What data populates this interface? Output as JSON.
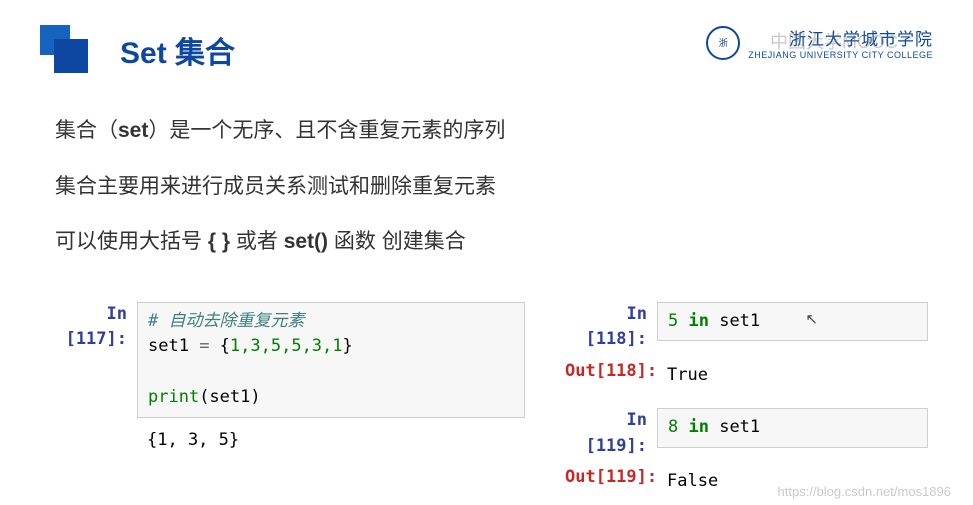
{
  "header": {
    "title": "Set 集合",
    "uni_cn": "浙江大学城市学院",
    "uni_en": "ZHEJIANG UNIVERSITY CITY COLLEGE",
    "watermark_mooc": "中国大学MOOC"
  },
  "body": {
    "line1_a": "集合（",
    "line1_b": "set",
    "line1_c": "）是一个无序、且不含重复元素的序列",
    "line2": "集合主要用来进行成员关系测试和删除重复元素",
    "line3_a": "可以使用大括号 ",
    "line3_b": "{ }",
    "line3_c": " 或者 ",
    "line3_d": "set()",
    "line3_e": " 函数 创建集合"
  },
  "cells": {
    "c117": {
      "prompt": "In [117]:",
      "comment": "# 自动去除重复元素",
      "assign_var": "set1 ",
      "assign_eq": "= ",
      "assign_open": "{",
      "assign_vals": "1,3,5,5,3,1",
      "assign_close": "}",
      "print_fn": "print",
      "print_arg": "(set1)",
      "output": "{1, 3, 5}"
    },
    "c118": {
      "prompt_in": "In [118]:",
      "code_num": "5",
      "code_kw": " in ",
      "code_var": "set1",
      "prompt_out": "Out[118]:",
      "output": "True"
    },
    "c119": {
      "prompt_in": "In [119]:",
      "code_num": "8",
      "code_kw": " in ",
      "code_var": "set1",
      "prompt_out": "Out[119]:",
      "output": "False"
    }
  },
  "footer": {
    "url_watermark": "https://blog.csdn.net/mos1896"
  }
}
